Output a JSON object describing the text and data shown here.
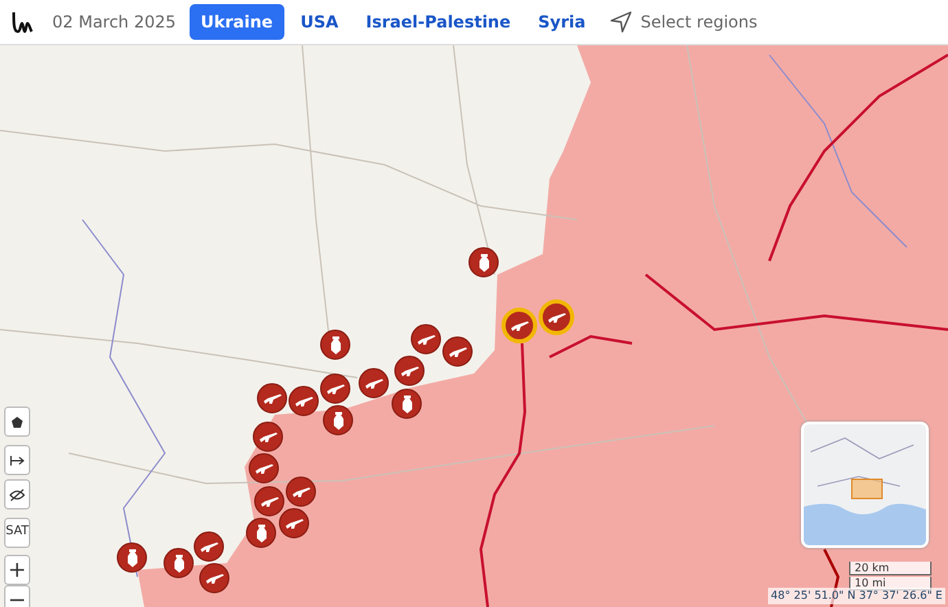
{
  "header": {
    "date": "02 March 2025",
    "tabs": [
      {
        "label": "Ukraine",
        "selected": true
      },
      {
        "label": "USA",
        "selected": false
      },
      {
        "label": "Israel-Palestine",
        "selected": false
      },
      {
        "label": "Syria",
        "selected": false
      }
    ],
    "select_regions": "Select regions"
  },
  "map": {
    "markers": [
      {
        "kind": "bomb",
        "highlighted": false
      },
      {
        "kind": "gun",
        "highlighted": true
      },
      {
        "kind": "gun",
        "highlighted": true
      },
      {
        "kind": "bomb",
        "highlighted": false
      },
      {
        "kind": "gun",
        "highlighted": false
      },
      {
        "kind": "gun",
        "highlighted": false
      },
      {
        "kind": "gun",
        "highlighted": false
      },
      {
        "kind": "gun",
        "highlighted": false
      },
      {
        "kind": "gun",
        "highlighted": false
      },
      {
        "kind": "gun",
        "highlighted": false
      },
      {
        "kind": "bomb",
        "highlighted": false
      },
      {
        "kind": "gun",
        "highlighted": false
      },
      {
        "kind": "bomb",
        "highlighted": false
      },
      {
        "kind": "gun",
        "highlighted": false
      },
      {
        "kind": "gun",
        "highlighted": false
      },
      {
        "kind": "gun",
        "highlighted": false
      },
      {
        "kind": "gun",
        "highlighted": false
      },
      {
        "kind": "gun",
        "highlighted": false
      },
      {
        "kind": "bomb",
        "highlighted": false
      },
      {
        "kind": "gun",
        "highlighted": false
      },
      {
        "kind": "bomb",
        "highlighted": false
      },
      {
        "kind": "gun",
        "highlighted": false
      },
      {
        "kind": "bomb",
        "highlighted": false
      }
    ],
    "controls": {
      "sat": "SAT",
      "zoom_in": "+",
      "zoom_out": "−"
    },
    "scale": [
      "20 km",
      "10 mi"
    ],
    "coordinates": "48° 25' 51.0\" N 37° 37' 26.6\" E"
  }
}
